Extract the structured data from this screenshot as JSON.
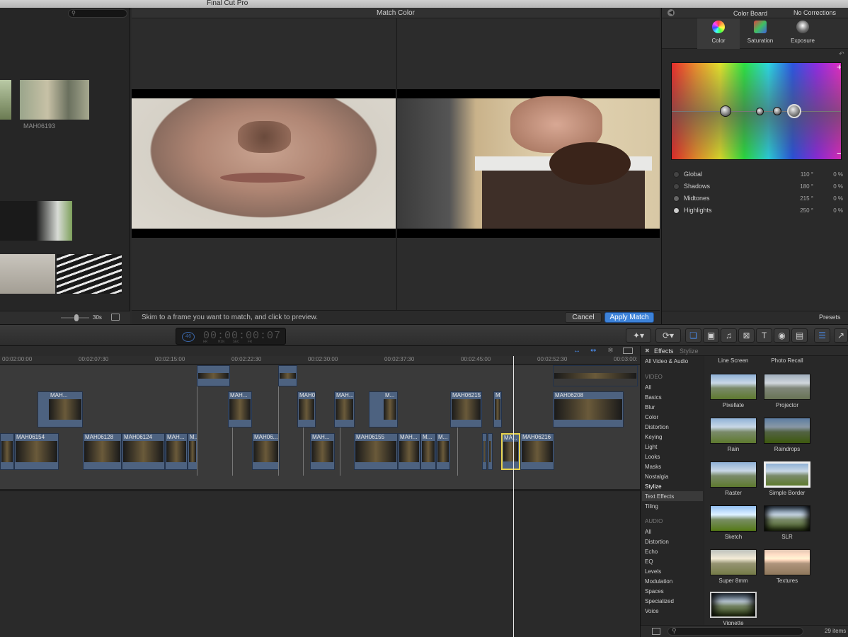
{
  "app": {
    "title": "Final Cut Pro"
  },
  "browser": {
    "clip_label": "MAH06193",
    "zoom_label": "30s"
  },
  "viewer": {
    "title": "Match Color",
    "hint": "Skim to a frame you want to match, and click to preview.",
    "cancel_label": "Cancel",
    "apply_label": "Apply Match"
  },
  "inspector": {
    "title": "Color Board",
    "status": "No Corrections",
    "tabs": [
      {
        "label": "Color"
      },
      {
        "label": "Saturation"
      },
      {
        "label": "Exposure"
      }
    ],
    "plus": "+",
    "minus": "−",
    "rows": [
      {
        "name": "Global",
        "deg": "110 °",
        "pct": "0 %"
      },
      {
        "name": "Shadows",
        "deg": "180 °",
        "pct": "0 %"
      },
      {
        "name": "Midtones",
        "deg": "215 °",
        "pct": "0 %"
      },
      {
        "name": "Highlights",
        "deg": "250 °",
        "pct": "0 %"
      }
    ],
    "presets_label": "Presets"
  },
  "toolbar": {
    "timecode": "00:00:00:07",
    "timecode_prefix": "46",
    "units": [
      "HR",
      "MIN",
      "SEC",
      "FR"
    ]
  },
  "timeline": {
    "ruler": [
      "00:02:00:00",
      "00:02:07:30",
      "00:02:15:00",
      "00:02:22:30",
      "00:02:30:00",
      "00:02:37:30",
      "00:02:45:00",
      "00:02:52:30",
      "00:03:00:"
    ],
    "clips_top": [
      "MAH...",
      "M...",
      "MAH...",
      "MAH06...",
      "MAH...",
      "M...",
      "MAH06215",
      "M",
      "MAH06208"
    ],
    "clips_main": [
      "MAH06154",
      "MAH06128",
      "MAH06124",
      "MAH...",
      "M...",
      "MAH06...",
      "MAH...",
      "MAH06155",
      "MAH...",
      "M...",
      "M...",
      "MA...",
      "MAH06216"
    ]
  },
  "effects": {
    "title": "Effects",
    "subtitle": "Stylize",
    "all_label": "All Video & Audio",
    "video_head": "VIDEO",
    "video_cats": [
      "All",
      "Basics",
      "Blur",
      "Color",
      "Distortion",
      "Keying",
      "Light",
      "Looks",
      "Masks",
      "Nostalgia",
      "Stylize",
      "Text Effects",
      "Tiling"
    ],
    "audio_head": "AUDIO",
    "audio_cats": [
      "All",
      "Distortion",
      "Echo",
      "EQ",
      "Levels",
      "Modulation",
      "Spaces",
      "Specialized",
      "Voice"
    ],
    "top_items": [
      "Line Screen",
      "Photo Recall"
    ],
    "items": [
      "Pixellate",
      "Projector",
      "Rain",
      "Raindrops",
      "Raster",
      "Simple Border",
      "Sketch",
      "SLR",
      "Super 8mm",
      "Textures",
      "Vignette"
    ],
    "count": "29 items"
  },
  "colors": {
    "accent": "#3d82d8",
    "selection": "#e8d24a"
  }
}
